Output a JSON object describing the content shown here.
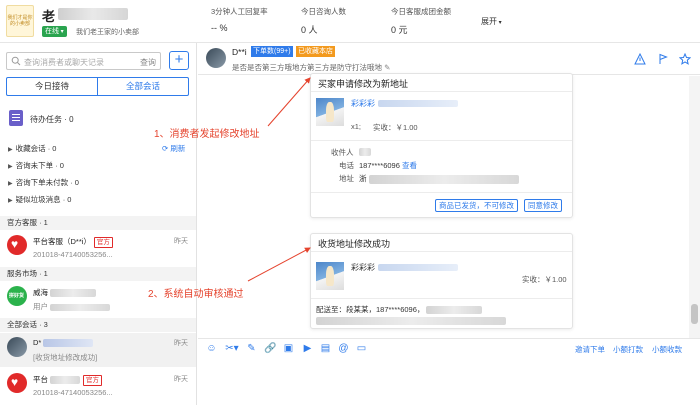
{
  "header": {
    "logo_text": "我们才是你的小卖部",
    "shop_name": "老",
    "status": "在线",
    "shop_desc": "我们老王家的小卖部",
    "stats": [
      {
        "label": "3分钟人工回复率",
        "value": "-- %"
      },
      {
        "label": "今日咨询人数",
        "value": "0 人"
      },
      {
        "label": "今日客服成团金额",
        "value": "0 元"
      }
    ],
    "expand": "展开"
  },
  "sidebar": {
    "search_placeholder": "查询消费者或聊天记录",
    "search_button": "查询",
    "add_button": "+",
    "tabs": [
      "今日接待",
      "全部会话"
    ],
    "task_label": "待办任务 · 0",
    "groups": [
      "收藏会话 · 0",
      "咨询未下单 · 0",
      "咨询下单未付款 · 0",
      "疑似垃圾消息 · 0"
    ],
    "refresh": "刷新",
    "sections": {
      "official": "官方客服 · 1",
      "service_market": "服务市场 · 1",
      "all_conversations": "全部会话 · 3"
    },
    "conversations": [
      {
        "name": "平台客服（D**i）",
        "tag": "官方",
        "time": "昨天",
        "msg": "201018-47140053256..."
      },
      {
        "name": "威海",
        "tag": "",
        "time": "",
        "msg": "用户"
      },
      {
        "name": "D*",
        "tag": "",
        "time": "昨天",
        "msg": "[收货地址修改成功]"
      },
      {
        "name": "平台",
        "tag": "官方",
        "time": "昨天",
        "msg": "201018-47140053256..."
      }
    ]
  },
  "chat": {
    "header": {
      "name": "D**i",
      "badge_orders": "下单数(99+)",
      "badge_favorite": "已收藏本店",
      "subtitle": "是否是否第三方哦地方第三方是防守打法哦地"
    },
    "card1": {
      "title": "买家申请修改为新地址",
      "product": "彩彩彩",
      "qty": "x1;",
      "paid": "实收：￥1.00",
      "receiver_label": "收件人",
      "phone_label": "电话",
      "phone": "187****6096",
      "view": "查看",
      "address_label": "地址",
      "address": "浙",
      "btn_shipped": "商品已发货，不可修改",
      "btn_agree": "同意修改"
    },
    "card2": {
      "title": "收货地址修改成功",
      "product": "彩彩彩",
      "paid": "实收：￥1.00",
      "delivery": "配送至：段某某，187****6096，"
    },
    "annotations": {
      "a1": "1、消费者发起修改地址",
      "a2": "2、系统自动审核通过"
    }
  },
  "toolbar": {
    "icons": [
      "smile-icon",
      "scissors-icon",
      "pen-icon",
      "link-icon",
      "image-icon",
      "video-icon",
      "card-icon",
      "at-icon",
      "folder-icon"
    ],
    "links": [
      "邀请下单",
      "小额打款",
      "小额收款"
    ]
  },
  "colors": {
    "accent": "#2f7bea",
    "online": "#2aa44f",
    "official": "#e12a2a",
    "annotation": "#e5432d",
    "favorite": "#f39a1e"
  }
}
